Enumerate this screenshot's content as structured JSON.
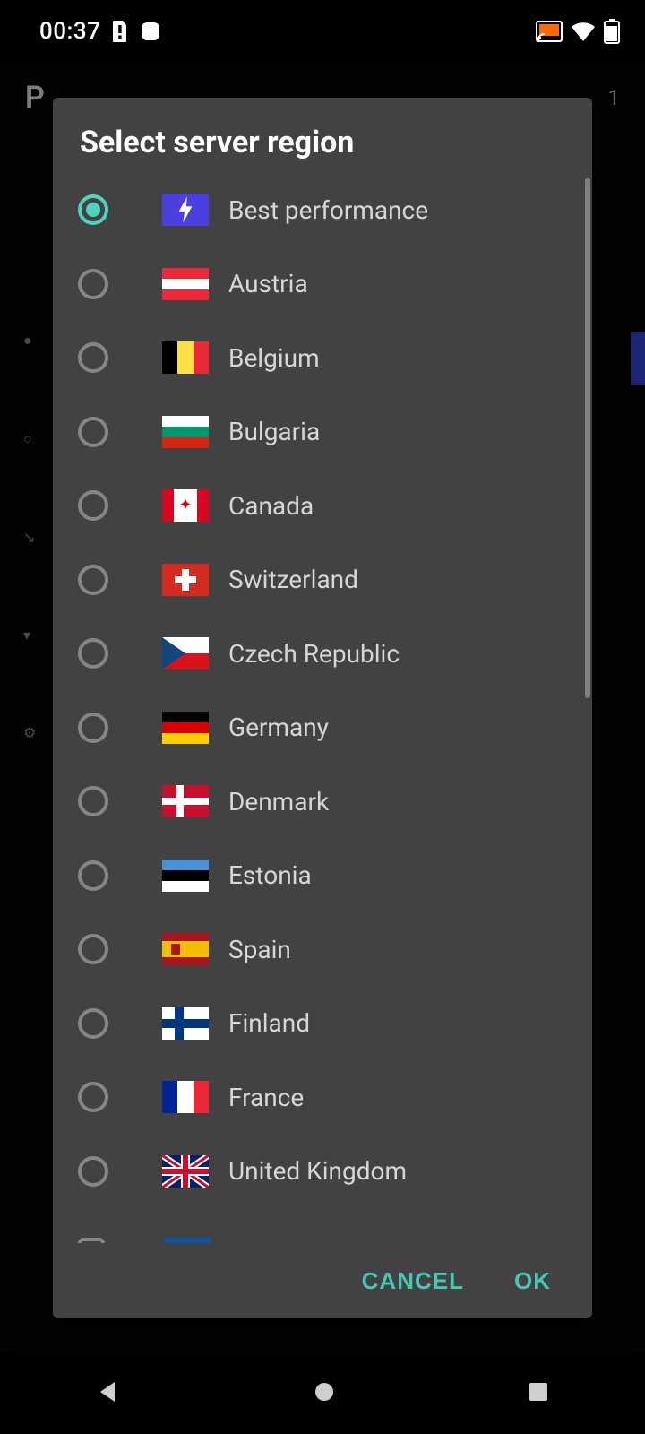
{
  "status": {
    "time": "00:37"
  },
  "background": {
    "title_peek": "P",
    "right_number": "1"
  },
  "dialog": {
    "title": "Select server region",
    "selected_index": 0,
    "items": [
      {
        "key": "best",
        "label": "Best performance",
        "flag": "lightning"
      },
      {
        "key": "at",
        "label": "Austria",
        "flag": "austria"
      },
      {
        "key": "be",
        "label": "Belgium",
        "flag": "belgium"
      },
      {
        "key": "bg",
        "label": "Bulgaria",
        "flag": "bulgaria"
      },
      {
        "key": "ca",
        "label": "Canada",
        "flag": "canada"
      },
      {
        "key": "ch",
        "label": "Switzerland",
        "flag": "switzerland"
      },
      {
        "key": "cz",
        "label": "Czech Republic",
        "flag": "czech"
      },
      {
        "key": "de",
        "label": "Germany",
        "flag": "germany"
      },
      {
        "key": "dk",
        "label": "Denmark",
        "flag": "denmark"
      },
      {
        "key": "ee",
        "label": "Estonia",
        "flag": "estonia"
      },
      {
        "key": "es",
        "label": "Spain",
        "flag": "spain"
      },
      {
        "key": "fi",
        "label": "Finland",
        "flag": "finland"
      },
      {
        "key": "fr",
        "label": "France",
        "flag": "france"
      },
      {
        "key": "gb",
        "label": "United Kingdom",
        "flag": "uk"
      }
    ],
    "cancel_label": "CANCEL",
    "ok_label": "OK"
  }
}
